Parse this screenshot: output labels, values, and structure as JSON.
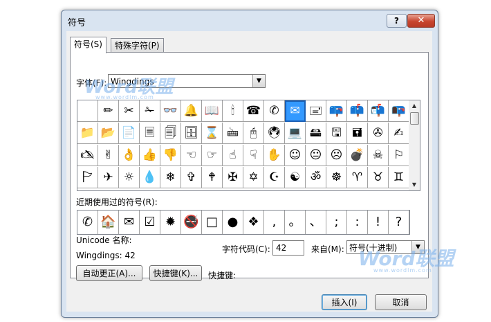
{
  "window": {
    "title": "符号",
    "help": "?",
    "close": "✕"
  },
  "tabs": [
    {
      "label": "符号(S)",
      "active": true
    },
    {
      "label": "特殊字符(P)",
      "active": false
    }
  ],
  "font": {
    "label": "字体(F):",
    "value": "Wingdings"
  },
  "symbols": [
    [
      "✏",
      "✂",
      "✁",
      "👓",
      "🔔",
      "📖",
      "🕯",
      "☎",
      "✆",
      "✉",
      "🖃",
      "📪",
      "📫",
      "📬",
      "📭"
    ],
    [
      "📁",
      "📂",
      "📄",
      "🗏",
      "🗐",
      "🗄",
      "⌛",
      "🖮",
      "🖰",
      "🖲",
      "💻",
      "🖴",
      "🖫",
      "🖬",
      "✇",
      "✍"
    ],
    [
      "🖎",
      "✌",
      "👌",
      "👍",
      "👎",
      "☜",
      "☞",
      "☝",
      "☟",
      "✋",
      "☺",
      "😐",
      "☹",
      "💣",
      "☠",
      "⚐"
    ],
    [
      "🏱",
      "✈",
      "☼",
      "💧",
      "❄",
      "✞",
      "🕈",
      "✠",
      "✡",
      "☪",
      "☯",
      "ॐ",
      "☸",
      "♈",
      "♉",
      "♊"
    ]
  ],
  "selected_symbol": "✉",
  "recent": {
    "label": "近期使用过的符号(R):",
    "items": [
      "✆",
      "🏠",
      "✉",
      "☑",
      "✹",
      "🚭",
      "□",
      "●",
      "❖",
      ",",
      "。",
      "、",
      ";",
      ":",
      "!",
      "?"
    ]
  },
  "unicode_name_label": "Unicode 名称:",
  "char_info": "Wingdings: 42",
  "char_code": {
    "label": "字符代码(C):",
    "value": "42"
  },
  "from": {
    "label": "来自(M):",
    "value": "符号(十进制)"
  },
  "buttons": {
    "autocorrect": "自动更正(A)...",
    "shortcut_key": "快捷键(K)...",
    "shortcut_label": "快捷键:",
    "insert": "插入(I)",
    "cancel": "取消"
  },
  "watermark": {
    "main": "Word联盟",
    "url": "www.wordlm.com"
  }
}
